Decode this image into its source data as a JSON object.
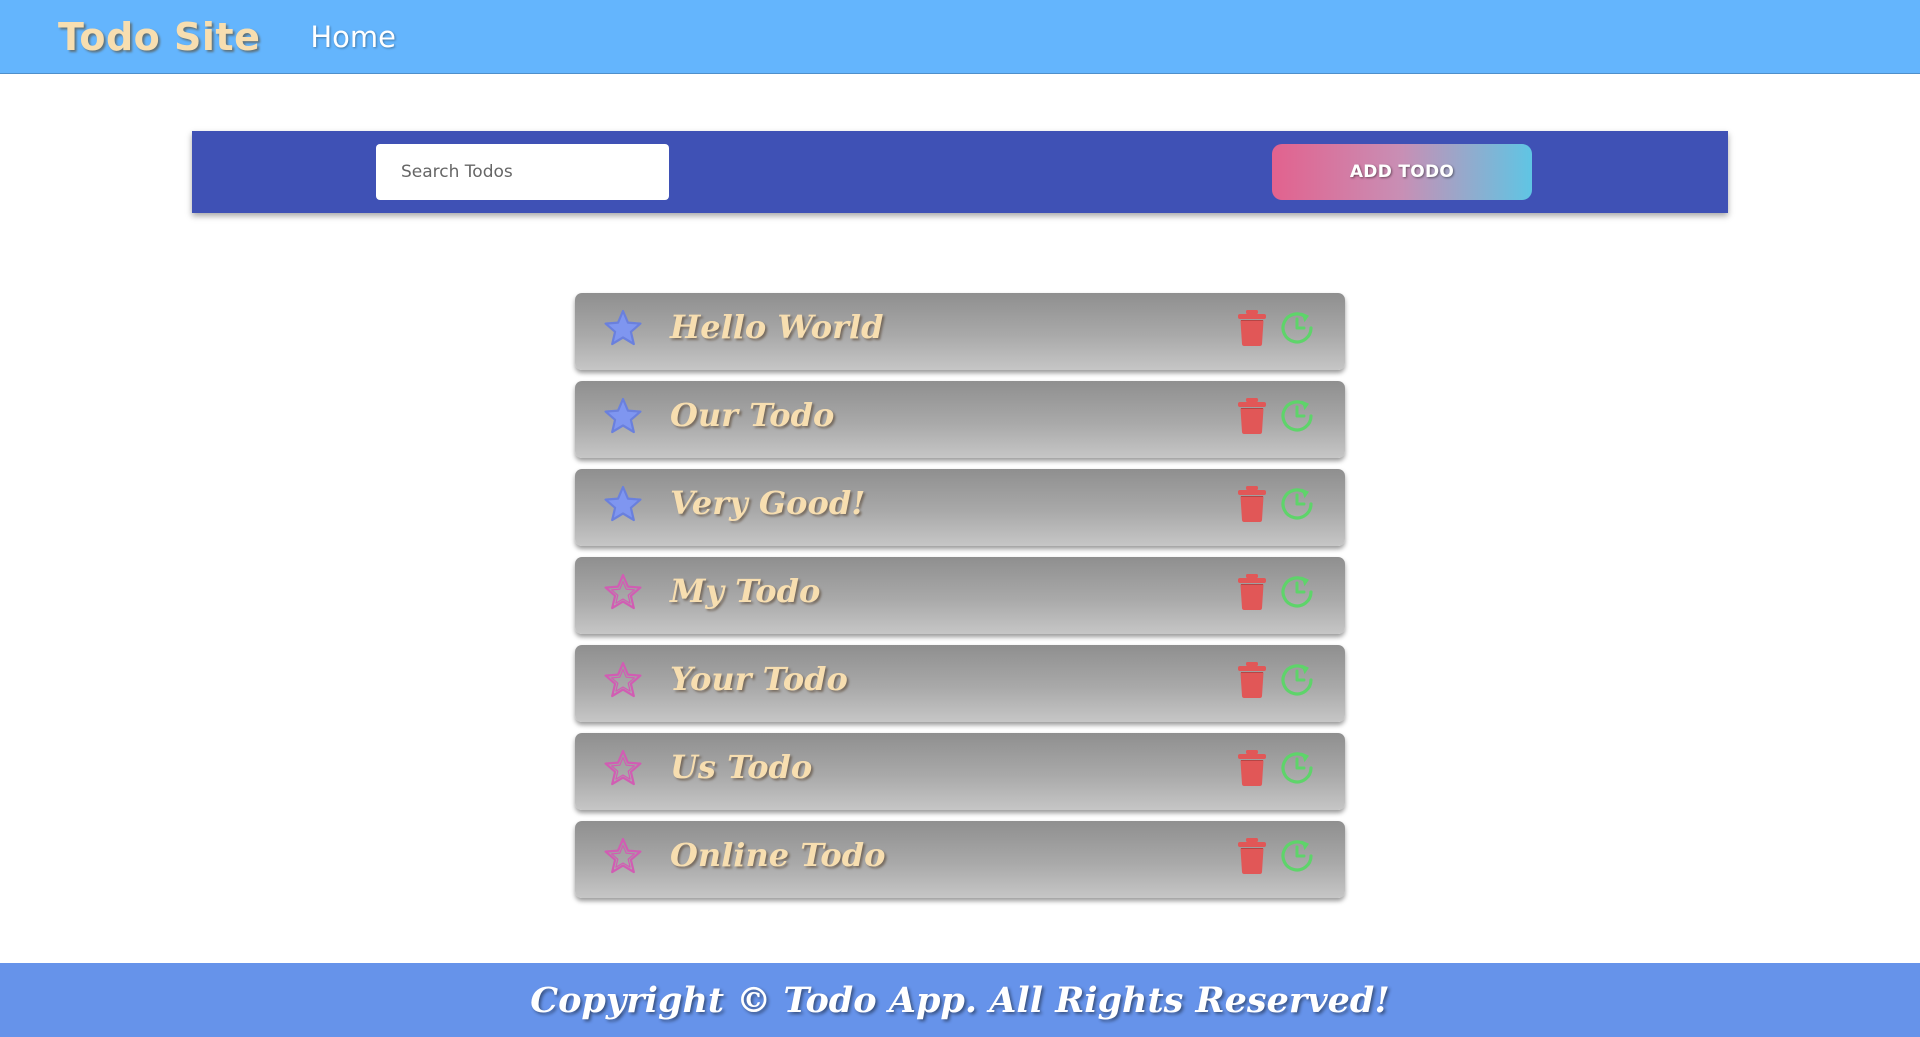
{
  "navbar": {
    "brand": "Todo Site",
    "links": [
      {
        "label": "Home"
      }
    ]
  },
  "toolbar": {
    "search_placeholder": "Search Todos",
    "search_value": "",
    "add_label": "ADD TODO"
  },
  "todos": [
    {
      "title": "Hello World",
      "starred": true
    },
    {
      "title": "Our Todo",
      "starred": true
    },
    {
      "title": "Very Good!",
      "starred": true
    },
    {
      "title": "My Todo",
      "starred": false
    },
    {
      "title": "Your Todo",
      "starred": false
    },
    {
      "title": "Us Todo",
      "starred": false
    },
    {
      "title": "Online Todo",
      "starred": false
    }
  ],
  "icons": {
    "star_filled": "star-filled-icon",
    "star_outline": "star-outline-icon",
    "trash": "trash-icon",
    "complete": "restore-clock-icon"
  },
  "colors": {
    "navbar": "#64b5fd",
    "brand_text": "#f7deb0",
    "toolbar": "#3f51b5",
    "add_gradient_start": "#e2628e",
    "add_gradient_end": "#5fc5e4",
    "star_filled": "#7f96f0",
    "star_outline": "#d15db3",
    "trash": "#e15757",
    "complete": "#5ed46a",
    "footer": "#6693ea"
  },
  "footer": {
    "text": "Copyright © Todo App. All Rights Reserved!"
  }
}
